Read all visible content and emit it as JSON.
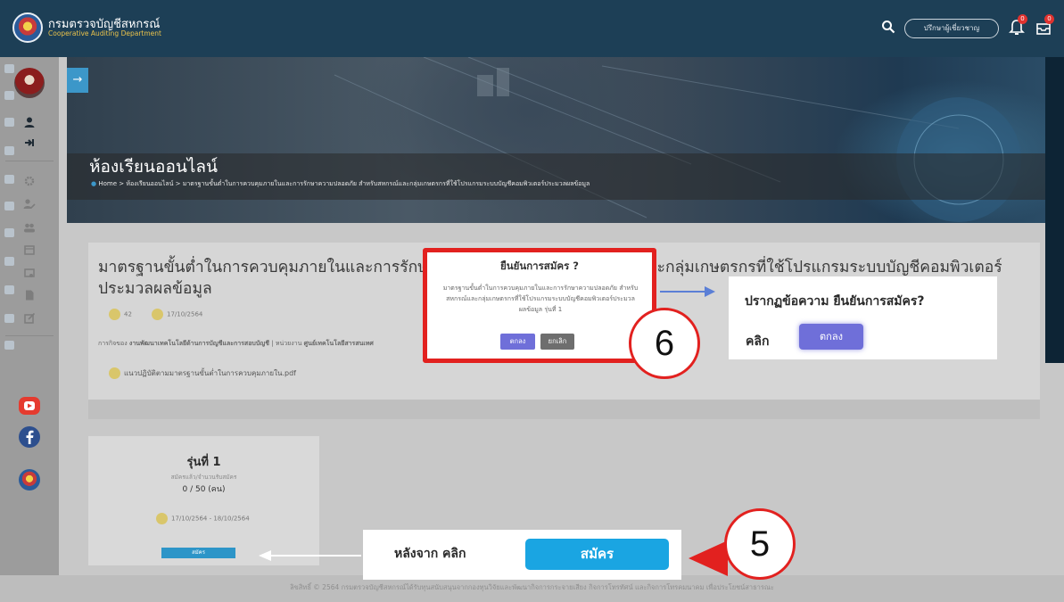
{
  "header": {
    "org_name_th": "กรมตรวจบัญชีสหกรณ์",
    "org_name_en": "Cooperative Auditing Department",
    "consult_button": "ปรึกษาผู้เชี่ยวชาญ",
    "notify_badge": "0",
    "cart_badge": "0"
  },
  "banner": {
    "title": "ห้องเรียนออนไลน์",
    "breadcrumb": [
      "Home",
      "ห้องเรียนออนไลน์",
      "มาตรฐานขั้นต่ำในการควบคุมภายในและการรักษาความปลอดภัย สำหรับสหกรณ์และกลุ่มเกษตรกรที่ใช้โปรแกรมระบบบัญชีคอมพิวเตอร์ประมวลผลข้อมูล"
    ]
  },
  "course": {
    "title": "มาตรฐานขั้นต่ำในการควบคุมภายในและการรักษาความปลอดภัย สำหรับสหกรณ์และกลุ่มเกษตรกรที่ใช้โปรแกรมระบบบัญชีคอมพิวเตอร์ประมวลผลข้อมูล",
    "views": "42",
    "date": "17/10/2564",
    "org_label": "การกิจของ",
    "org_value": "งานพัฒนาเทคโนโลยีด้านการบัญชีและการสอบบัญชี",
    "dept_label": "หน่วยงาน",
    "dept_value": "ศูนย์เทคโนโลยีสารสนเทศ",
    "file": "แนวปฏิบัติตามมาตรฐานขั้นต่ำในการควบคุมภายใน.pdf"
  },
  "round": {
    "title": "รุ่นที่ 1",
    "sub": "สมัครแล้ว/จำนวนรับสมัคร",
    "count": "0 / 50 (คน)",
    "dates": "17/10/2564 - 18/10/2564",
    "apply": "สมัคร"
  },
  "footer": "ลิขสิทธิ์ © 2564 กรมตรวจบัญชีสหกรณ์ได้รับทุนสนับสนุนจากกองทุนวิจัยและพัฒนากิจการกระจายเสียง กิจการโทรทัศน์ และกิจการโทรคมนาคม เพื่อประโยชน์สาธารณะ",
  "modal": {
    "title": "ยืนยันการสมัคร ?",
    "body": "มาตรฐานขั้นต่ำในการควบคุมภายในและการรักษาความปลอดภัย สำหรับสหกรณ์และกลุ่มเกษตรกรที่ใช้โปรแกรมระบบบัญชีคอมพิวเตอร์ประมวลผลข้อมูล รุ่นที่ 1",
    "ok": "ตกลง",
    "cancel": "ยกเลิก"
  },
  "annotations": {
    "step6": "6",
    "step5": "5",
    "callout_text": "ปรากฏข้อความ ยืนยันการสมัคร?",
    "callout_click": "คลิก",
    "callout_button": "ตกลง",
    "after_text": "หลังจาก คลิก",
    "after_button": "สมัคร"
  },
  "colors": {
    "topbar": "#1d3f56",
    "modal_border": "#e2211f",
    "ok_button": "#6f6fd9",
    "apply_button": "#1aa5e2"
  }
}
